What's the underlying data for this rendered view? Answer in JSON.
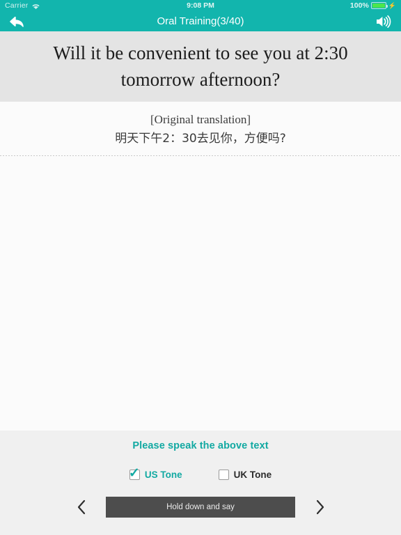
{
  "statusbar": {
    "carrier": "Carrier",
    "wifi_icon": "wifi-icon",
    "time": "9:08 PM",
    "battery_percent": "100%",
    "battery_icon": "battery-full-icon",
    "charging_icon": "lightning-bolt-icon"
  },
  "navbar": {
    "title": "Oral Training(3/40)",
    "back_icon": "back-arrow-icon",
    "speaker_icon": "speaker-volume-icon",
    "background_color": "#12b5ad"
  },
  "question": {
    "text": "Will it be convenient to see you at 2:30 tomorrow afternoon?",
    "background_color": "#e4e4e4"
  },
  "translation": {
    "label": "[Original translation]",
    "text": "明天下午2：30去见你，方便吗?"
  },
  "bottom": {
    "prompt": "Please speak the above text",
    "prompt_color": "#12a9a2",
    "tones": [
      {
        "label": "US Tone",
        "checked": true,
        "check_icon": "checkmark-icon"
      },
      {
        "label": "UK Tone",
        "checked": false,
        "check_icon": ""
      }
    ],
    "prev_icon": "chevron-left-icon",
    "next_icon": "chevron-right-icon",
    "record_label": "Hold down and say",
    "record_color": "#4d4d4d"
  }
}
